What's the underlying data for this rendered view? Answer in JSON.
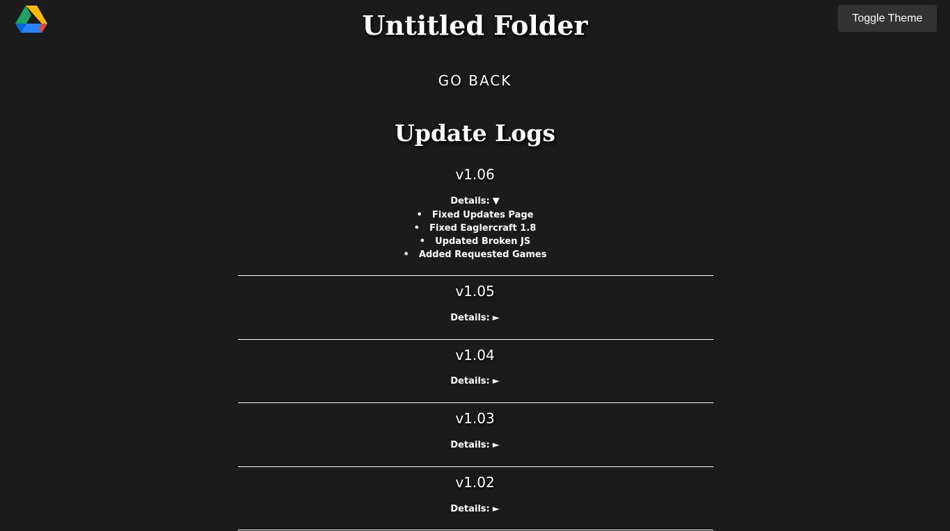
{
  "header": {
    "logo_icon": "google-drive-icon",
    "title": "Untitled Folder",
    "toggle_theme_label": "Toggle Theme",
    "go_back_label": "GO BACK"
  },
  "main": {
    "section_title": "Update Logs",
    "details_label": "Details:",
    "arrow_expanded": "▼",
    "arrow_collapsed": "►",
    "logs": [
      {
        "version": "v1.06",
        "expanded": true,
        "items": [
          "Fixed Updates Page",
          "Fixed Eaglercraft 1.8",
          "Updated Broken JS",
          "Added Requested Games"
        ]
      },
      {
        "version": "v1.05",
        "expanded": false
      },
      {
        "version": "v1.04",
        "expanded": false
      },
      {
        "version": "v1.03",
        "expanded": false
      },
      {
        "version": "v1.02",
        "expanded": false
      }
    ]
  },
  "colors": {
    "background": "#1b1b1b",
    "text": "#ffffff",
    "button_bg": "#333333",
    "drive_green": "#1ea362",
    "drive_yellow": "#ffba00",
    "drive_blue": "#2684fc",
    "drive_red": "#ea4335"
  }
}
